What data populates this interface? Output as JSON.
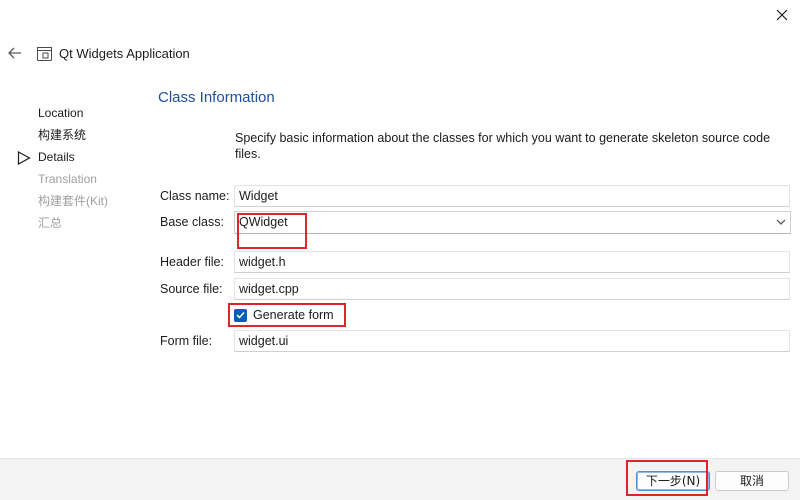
{
  "window": {
    "title": "Qt Widgets Application"
  },
  "icons": {
    "close": "close-icon",
    "back": "back-arrow-icon",
    "app": "qt-app-icon",
    "current_step": "play-arrow-icon",
    "dropdown": "chevron-down-icon",
    "check": "checkmark-icon"
  },
  "steps": [
    {
      "label": "Location",
      "state": "done"
    },
    {
      "label": "构建系统",
      "state": "done"
    },
    {
      "label": "Details",
      "state": "current"
    },
    {
      "label": "Translation",
      "state": "pending"
    },
    {
      "label": "构建套件(Kit)",
      "state": "pending"
    },
    {
      "label": "汇总",
      "state": "pending"
    }
  ],
  "page": {
    "title": "Class Information",
    "description": "Specify basic information about the classes for which you want to generate skeleton source code files."
  },
  "form": {
    "class_name": {
      "label": "Class name:",
      "value": "Widget"
    },
    "base_class": {
      "label": "Base class:",
      "value": "QWidget"
    },
    "header_file": {
      "label": "Header file:",
      "value": "widget.h"
    },
    "source_file": {
      "label": "Source file:",
      "value": "widget.cpp"
    },
    "generate_form": {
      "label": "Generate form",
      "checked": true
    },
    "form_file": {
      "label": "Form file:",
      "value": "widget.ui"
    }
  },
  "footer": {
    "next_label": "下一步(N)",
    "cancel_label": "取消"
  },
  "colors": {
    "accent": "#005fb8",
    "title_blue": "#1f4f9e",
    "highlight_red": "#e0242b",
    "disabled_text": "#a0a0a0"
  }
}
